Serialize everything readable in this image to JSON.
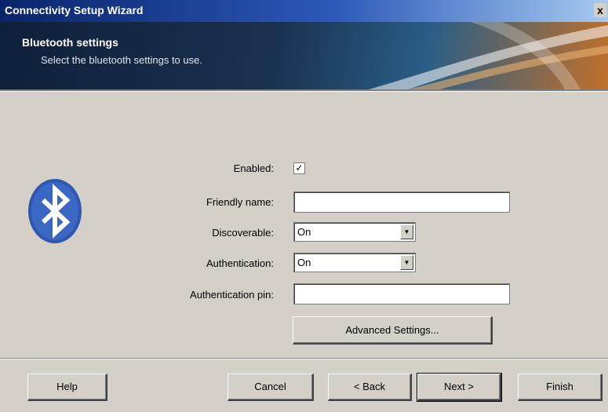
{
  "window": {
    "title": "Connectivity Setup Wizard",
    "close_label": "x"
  },
  "banner": {
    "title": "Bluetooth settings",
    "subtitle": "Select the bluetooth settings to use."
  },
  "form": {
    "enabled_label": "Enabled:",
    "enabled_checked": true,
    "enabled_mark": "✓",
    "friendly_name_label": "Friendly name:",
    "friendly_name_value": "",
    "discoverable_label": "Discoverable:",
    "discoverable_value": "On",
    "authentication_label": "Authentication:",
    "authentication_value": "On",
    "auth_pin_label": "Authentication pin:",
    "auth_pin_value": "",
    "advanced_label": "Advanced Settings..."
  },
  "buttons": {
    "help": "Help",
    "cancel": "Cancel",
    "back": "< Back",
    "next": "Next >",
    "finish": "Finish"
  },
  "icons": {
    "logo": "bluetooth-logo",
    "dropdown": "chevron-down-icon"
  },
  "colors": {
    "titlebar": "#0a246a",
    "bluetooth": "#2f57b0",
    "face": "#d4d0c8"
  }
}
